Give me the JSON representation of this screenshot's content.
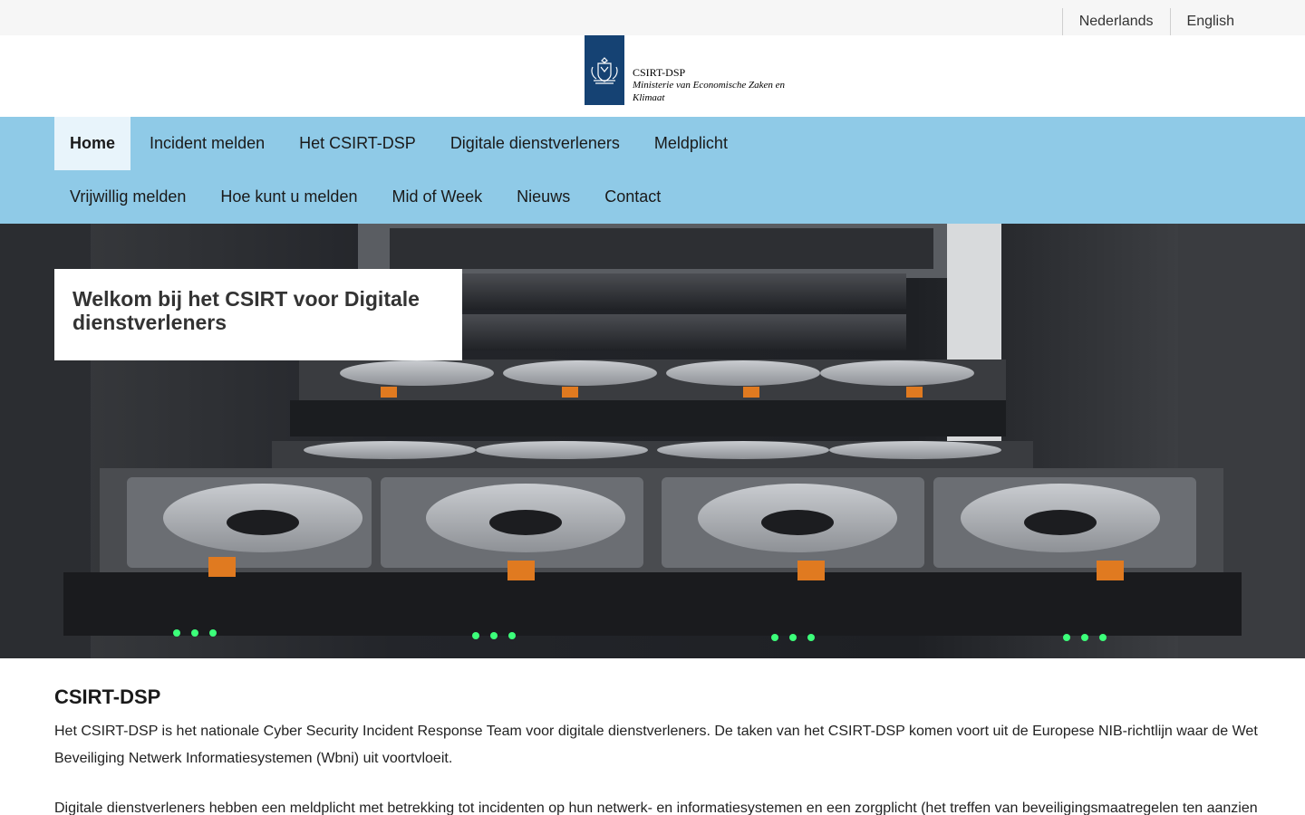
{
  "languages": [
    {
      "label": "Nederlands"
    },
    {
      "label": "English"
    }
  ],
  "logo": {
    "name": "CSIRT-DSP",
    "ministry": "Ministerie van Economische Zaken en",
    "ministry_cont": "Klimaat",
    "emblem_icon": "dutch-coat-of-arms-icon",
    "brand_color": "#154273"
  },
  "nav": {
    "row1": [
      {
        "label": "Home",
        "active": true
      },
      {
        "label": "Incident melden"
      },
      {
        "label": "Het CSIRT-DSP"
      },
      {
        "label": "Digitale dienstverleners"
      },
      {
        "label": "Meldplicht"
      }
    ],
    "row2": [
      {
        "label": "Vrijwillig melden"
      },
      {
        "label": "Hoe kunt u melden"
      },
      {
        "label": "Mid of Week"
      },
      {
        "label": "Nieuws"
      },
      {
        "label": "Contact"
      }
    ],
    "bg_color": "#8fcae7"
  },
  "hero": {
    "title": "Welkom bij het CSIRT voor Digitale dienstverleners",
    "image": "server-rack-with-hard-drives"
  },
  "content": {
    "heading": "CSIRT-DSP",
    "paragraph1": "Het CSIRT-DSP is het nationale Cyber Security Incident Response Team voor digitale dienstverleners. De taken van het CSIRT-DSP komen voort uit de Europese NIB-richtlijn waar de Wet Beveiliging Netwerk Informatiesystemen (Wbni) uit voortvloeit.",
    "paragraph2": "Digitale dienstverleners hebben een meldplicht met betrekking tot incidenten op hun netwerk- en informatiesystemen en een zorgplicht (het treffen van beveiligingsmaatregelen ten aanzien"
  }
}
